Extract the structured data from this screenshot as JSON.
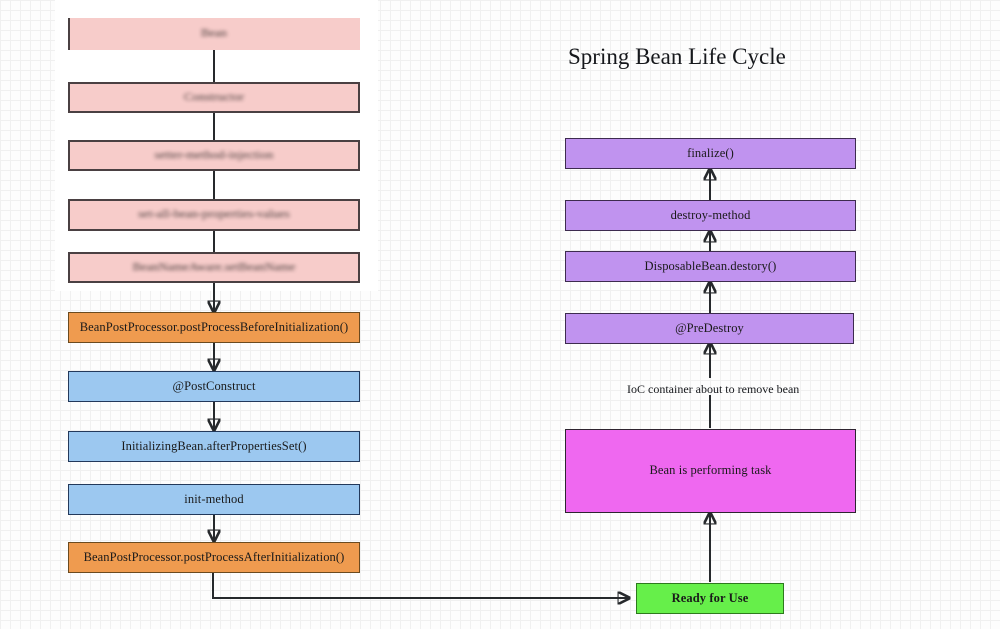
{
  "diagram": {
    "title": "Spring Bean Life Cycle",
    "background_color": "#fdfdfd",
    "grid": "10px minor / 50px major light grey graph paper"
  },
  "palette": {
    "pink": "#f7ccca",
    "orange": "#ef9b4f",
    "blue": "#9cc8f0",
    "purple": "#c093ef",
    "magenta": "#ef68f0",
    "green": "#66ef4a",
    "stroke": "#26292c"
  },
  "left_column": {
    "redacted_nodes": [
      {
        "label": "Bean",
        "redacted": true,
        "color": "pink"
      },
      {
        "label": "Constructor",
        "redacted": true,
        "color": "pink"
      },
      {
        "label": "setter-method-injection",
        "redacted": true,
        "color": "pink"
      },
      {
        "label": "set-all-bean-properties-values",
        "redacted": true,
        "color": "pink"
      },
      {
        "label": "BeanNameAware.setBeanName",
        "redacted": true,
        "color": "pink"
      }
    ],
    "nodes": [
      {
        "label": "BeanPostProcessor.postProcessBeforeInitialization()",
        "color": "orange"
      },
      {
        "label": "@PostConstruct",
        "color": "blue"
      },
      {
        "label": "InitializingBean.afterPropertiesSet()",
        "color": "blue"
      },
      {
        "label": "init-method",
        "color": "blue"
      },
      {
        "label": "BeanPostProcessor.postProcessAfterInitialization()",
        "color": "orange"
      }
    ]
  },
  "right_column": {
    "nodes": [
      {
        "label": "finalize()",
        "color": "purple"
      },
      {
        "label": "destroy-method",
        "color": "purple"
      },
      {
        "label": "DisposableBean.destory()",
        "color": "purple"
      },
      {
        "label": "@PreDestroy",
        "color": "purple"
      },
      {
        "label": "Bean is performing task",
        "color": "magenta"
      }
    ],
    "edge_label": "IoC container about to remove bean"
  },
  "bottom": {
    "ready_node": {
      "label": "Ready for Use",
      "color": "green"
    }
  }
}
